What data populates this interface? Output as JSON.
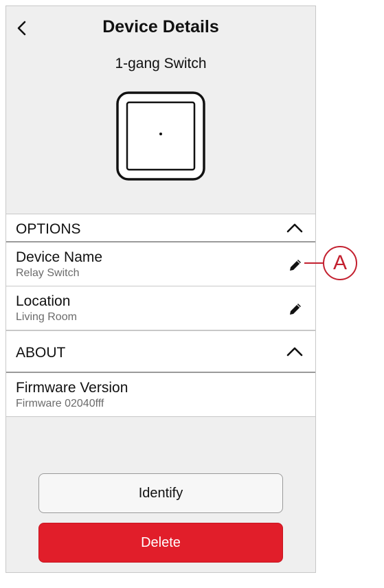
{
  "header": {
    "title": "Device Details",
    "device_type": "1-gang Switch"
  },
  "options": {
    "label": "OPTIONS",
    "items": [
      {
        "title": "Device Name",
        "value": "Relay Switch"
      },
      {
        "title": "Location",
        "value": "Living Room"
      }
    ]
  },
  "about": {
    "label": "ABOUT",
    "items": [
      {
        "title": "Firmware Version",
        "value": "Firmware 02040fff"
      }
    ]
  },
  "buttons": {
    "identify": "Identify",
    "delete": "Delete"
  },
  "callout": {
    "label": "A"
  },
  "colors": {
    "delete_red": "#e11e2a",
    "callout_red": "#c3202f",
    "background": "#efefef"
  },
  "icons": {
    "back": "chevron-left-icon",
    "collapse": "chevron-up-icon",
    "edit": "pencil-icon"
  }
}
